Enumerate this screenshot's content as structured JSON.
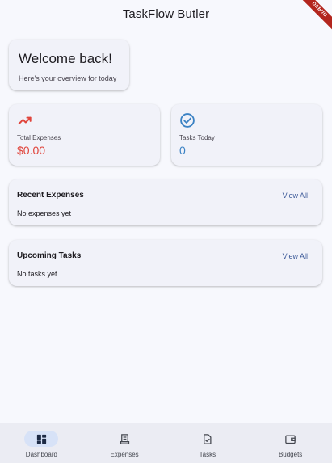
{
  "app_bar": {
    "title": "TaskFlow Butler"
  },
  "debug_banner": "DEBUG",
  "welcome": {
    "title": "Welcome back!",
    "subtitle": "Here's your overview for today"
  },
  "stats": {
    "expenses": {
      "label": "Total Expenses",
      "value": "$0.00",
      "icon": "trending-up-icon",
      "color": "#e0453c"
    },
    "tasks": {
      "label": "Tasks Today",
      "value": "0",
      "icon": "check-circle-icon",
      "color": "#3b82c4"
    }
  },
  "recent_expenses": {
    "title": "Recent Expenses",
    "link": "View All",
    "empty": "No expenses yet"
  },
  "upcoming_tasks": {
    "title": "Upcoming Tasks",
    "link": "View All",
    "empty": "No tasks yet"
  },
  "nav": {
    "items": [
      {
        "label": "Dashboard",
        "icon": "dashboard-icon",
        "active": true
      },
      {
        "label": "Expenses",
        "icon": "receipt-icon",
        "active": false
      },
      {
        "label": "Tasks",
        "icon": "task-icon",
        "active": false
      },
      {
        "label": "Budgets",
        "icon": "wallet-icon",
        "active": false
      }
    ]
  }
}
